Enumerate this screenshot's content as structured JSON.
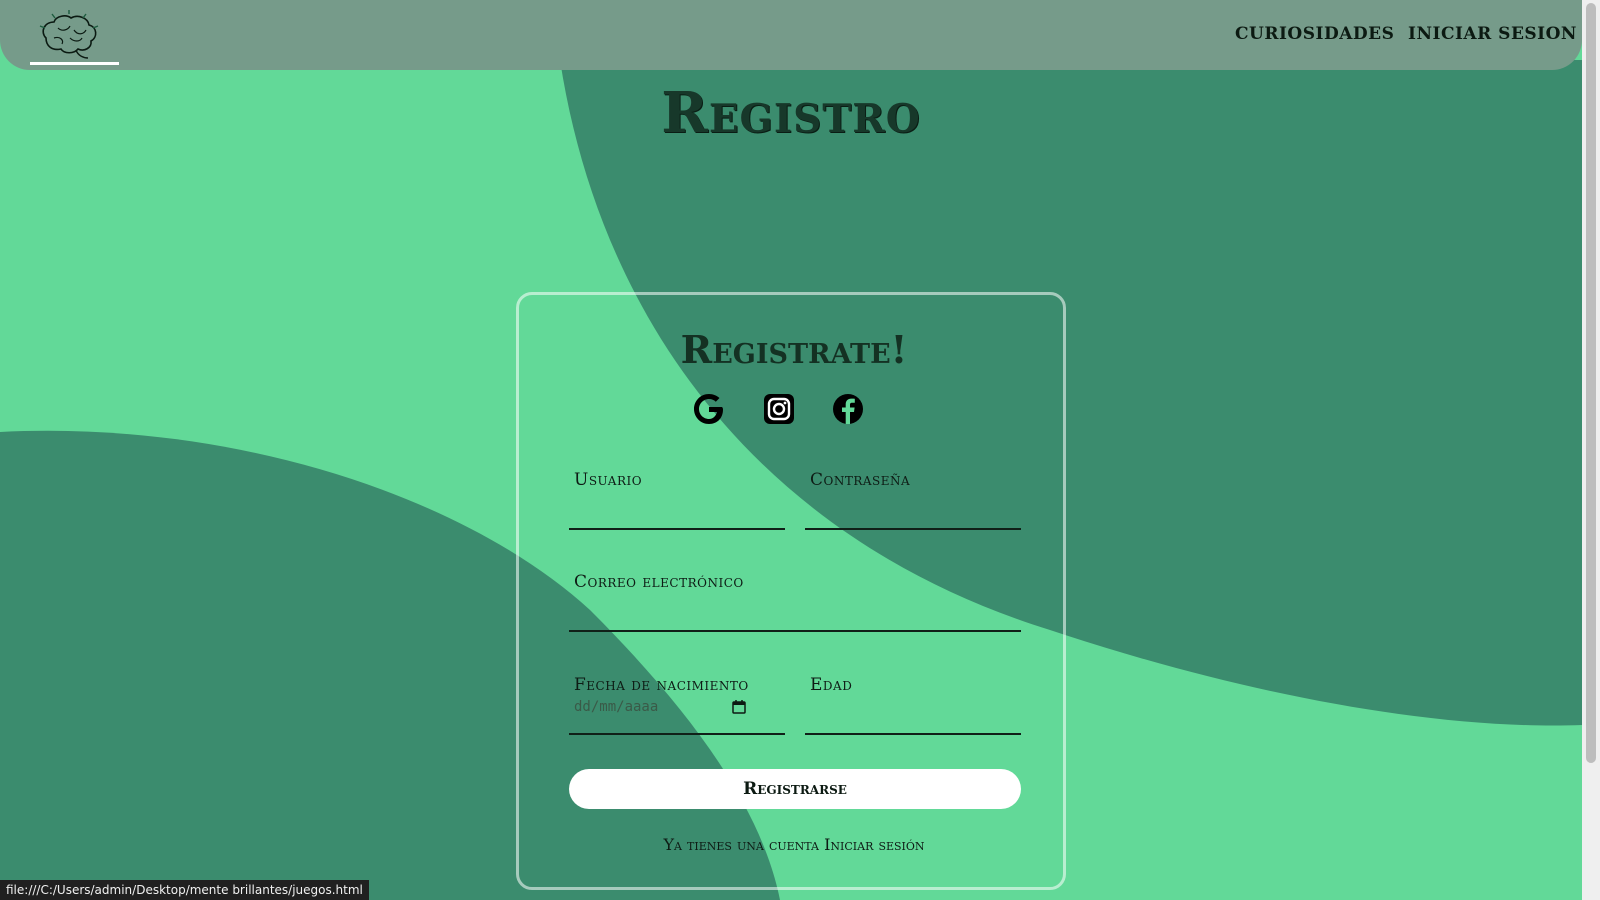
{
  "nav": {
    "logo_alt": "brain-logo",
    "links": [
      {
        "label": "CURIOSIDADES"
      },
      {
        "label": "INICIAR SESION"
      }
    ]
  },
  "page": {
    "title": "Registro"
  },
  "form": {
    "title": "Registrate!",
    "social": [
      "google-icon",
      "instagram-icon",
      "facebook-icon"
    ],
    "fields": {
      "usuario": {
        "label": "Usuario",
        "value": ""
      },
      "contrasena": {
        "label": "Contraseña",
        "value": ""
      },
      "correo": {
        "label": "Correo electrónico",
        "value": ""
      },
      "fecha": {
        "label": "Fecha de nacimiento",
        "placeholder": "dd/mm/aaaa"
      },
      "edad": {
        "label": "Edad",
        "value": ""
      }
    },
    "submit_label": "Registrarse",
    "footer": {
      "text": "Ya tienes una cuenta",
      "link": "Iniciar sesión"
    }
  },
  "status_bar": {
    "url": "file:///C:/Users/admin/Desktop/mente brillantes/juegos.html"
  },
  "colors": {
    "light_green": "#62d998",
    "dark_green": "#3b8c6e",
    "nav_bg": "#769b8a",
    "button_bg": "#ffffff"
  }
}
